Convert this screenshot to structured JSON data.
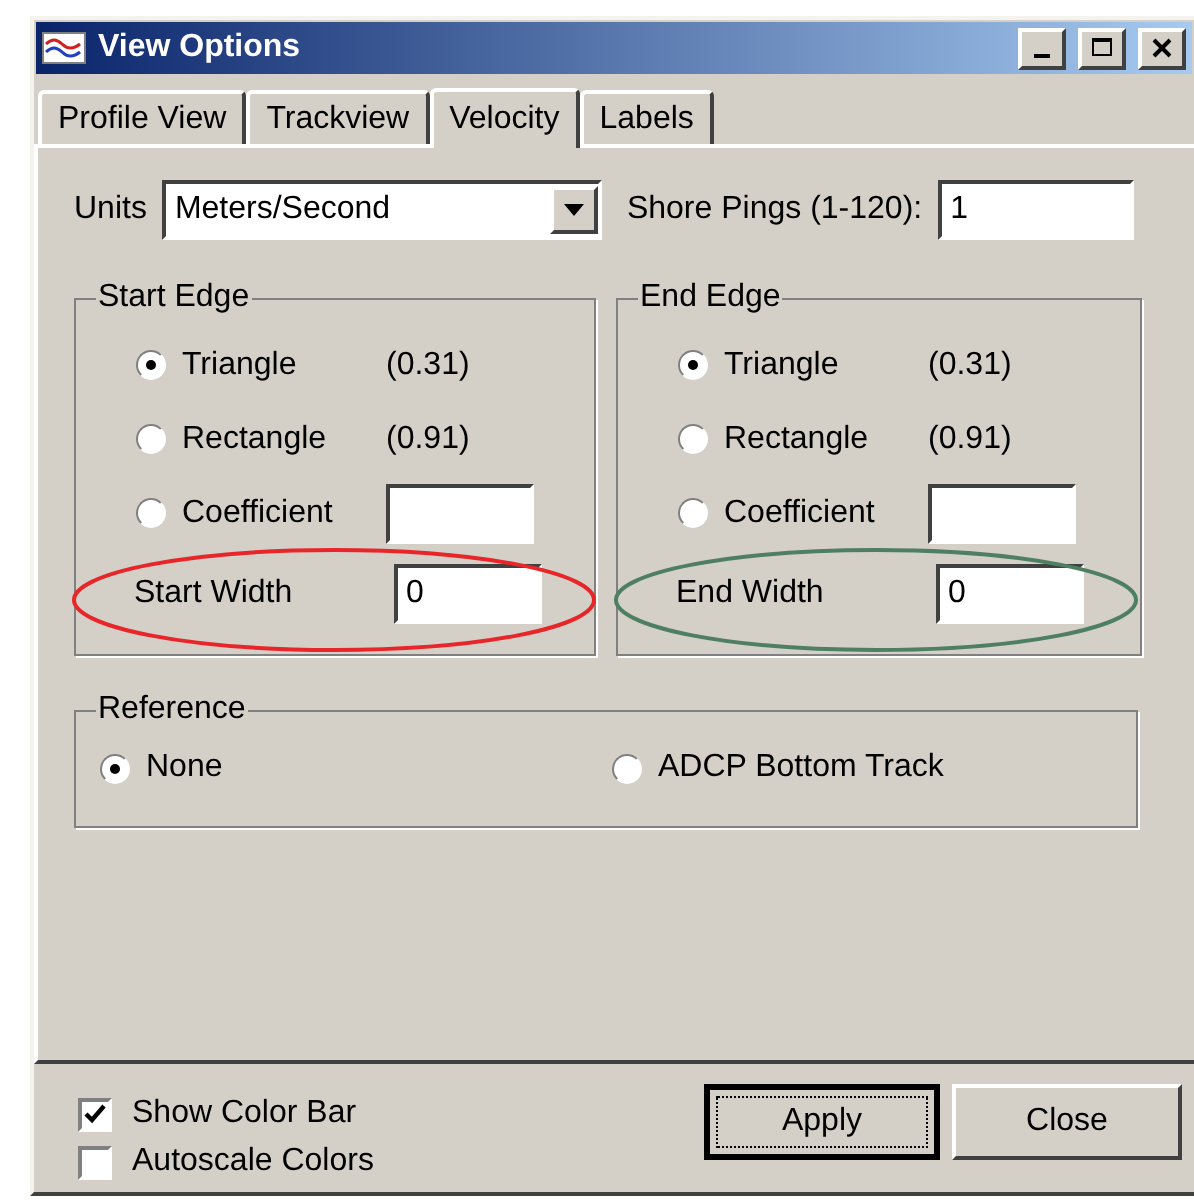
{
  "window": {
    "title": "View Options"
  },
  "tabs": [
    {
      "label": "Profile View",
      "selected": false
    },
    {
      "label": "Trackview",
      "selected": false
    },
    {
      "label": "Velocity",
      "selected": true
    },
    {
      "label": "Labels",
      "selected": false
    }
  ],
  "units": {
    "label": "Units",
    "value": "Meters/Second"
  },
  "shore_pings": {
    "label": "Shore Pings (1-120):",
    "value": "1"
  },
  "edges": [
    {
      "title": "Start Edge",
      "options": [
        {
          "kind": "value",
          "label": "Triangle",
          "value": "(0.31)",
          "selected": true
        },
        {
          "kind": "value",
          "label": "Rectangle",
          "value": "(0.91)",
          "selected": false
        },
        {
          "kind": "field",
          "label": "Coefficient",
          "selected": false
        }
      ],
      "width": {
        "label": "Start Width",
        "value": "0"
      },
      "highlight": {
        "color": "#e8262a"
      }
    },
    {
      "title": "End Edge",
      "options": [
        {
          "kind": "value",
          "label": "Triangle",
          "value": "(0.31)",
          "selected": true
        },
        {
          "kind": "value",
          "label": "Rectangle",
          "value": "(0.91)",
          "selected": false
        },
        {
          "kind": "field",
          "label": "Coefficient",
          "selected": false
        }
      ],
      "width": {
        "label": "End Width",
        "value": "0"
      },
      "highlight": {
        "color": "#4f7f62"
      }
    }
  ],
  "reference": {
    "title": "Reference",
    "options": [
      {
        "label": "None",
        "selected": true
      },
      {
        "label": "ADCP Bottom Track",
        "selected": false
      }
    ]
  },
  "checkboxes": [
    {
      "label": "Show Color Bar",
      "checked": true
    },
    {
      "label": "Autoscale Colors",
      "checked": false
    }
  ],
  "buttons": [
    {
      "label": "Apply",
      "default": true
    },
    {
      "label": "Close",
      "default": false
    }
  ]
}
